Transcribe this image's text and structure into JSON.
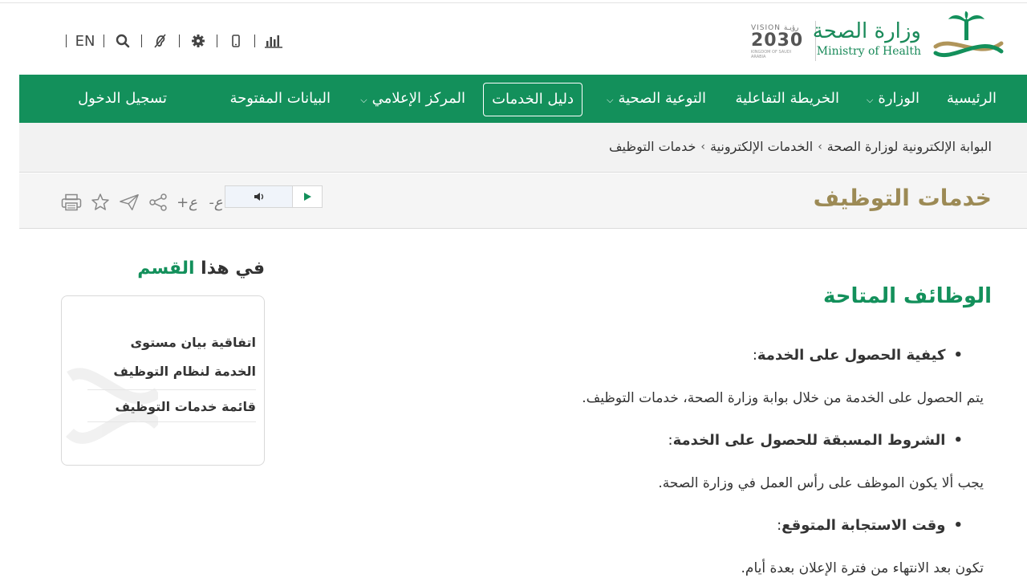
{
  "header": {
    "logo_ar": "وزارة الصحة",
    "logo_en": "Ministry of Health",
    "vision_top": "VISION رؤيـة",
    "vision_year": "2030",
    "vision_sub": "KINGDOM OF SAUDI ARABIA",
    "lang_label": "EN",
    "tools": [
      "search-icon",
      "accessibility-icon",
      "gear-icon",
      "mobile-icon",
      "chart-icon"
    ]
  },
  "nav": {
    "items": [
      {
        "label": "الرئيسية",
        "dropdown": false
      },
      {
        "label": "الوزارة",
        "dropdown": true
      },
      {
        "label": "الخريطة التفاعلية",
        "dropdown": false
      },
      {
        "label": "التوعية الصحية",
        "dropdown": true
      },
      {
        "label": "دليل الخدمات",
        "dropdown": false,
        "boxed": true
      },
      {
        "label": "المركز الإعلامي",
        "dropdown": true
      },
      {
        "label": "البيانات المفتوحة",
        "dropdown": false
      }
    ],
    "login_label": "تسجيل الدخول",
    "chevron": "⌵"
  },
  "breadcrumb": {
    "items": [
      "البوابة الإلكترونية لوزارة الصحة",
      "الخدمات الإلكترونية",
      "خدمات التوظيف"
    ],
    "sep": "›"
  },
  "page": {
    "title": "خدمات التوظيف",
    "font_increase": "+ع",
    "font_decrease": "-ع"
  },
  "sidebar": {
    "heading_part1": "في هذا",
    "heading_part2": "القسم",
    "links": [
      "اتفاقية بيان مستوى الخدمة لنظام التوظيف",
      "قائمة خدمات التوظيف"
    ]
  },
  "main": {
    "heading": "الوظائف المتاحة",
    "sections": [
      {
        "title": "كيفية الحصول على الخدمة",
        "text": "يتم الحصول على الخدمة من خلال بوابة وزارة الصحة، خدمات التوظيف."
      },
      {
        "title": "الشروط المسبقة للحصول على الخدمة",
        "text": "يجب ألا يكون الموظف على رأس العمل في وزارة الصحة."
      },
      {
        "title": "وقت الاستجابة المتوقع",
        "text": "تكون بعد الانتهاء من فترة الإعلان بعدة أيام."
      }
    ],
    "colon": ":"
  },
  "colors": {
    "brand_green": "#13905b",
    "title_gold": "#9c8a55"
  }
}
